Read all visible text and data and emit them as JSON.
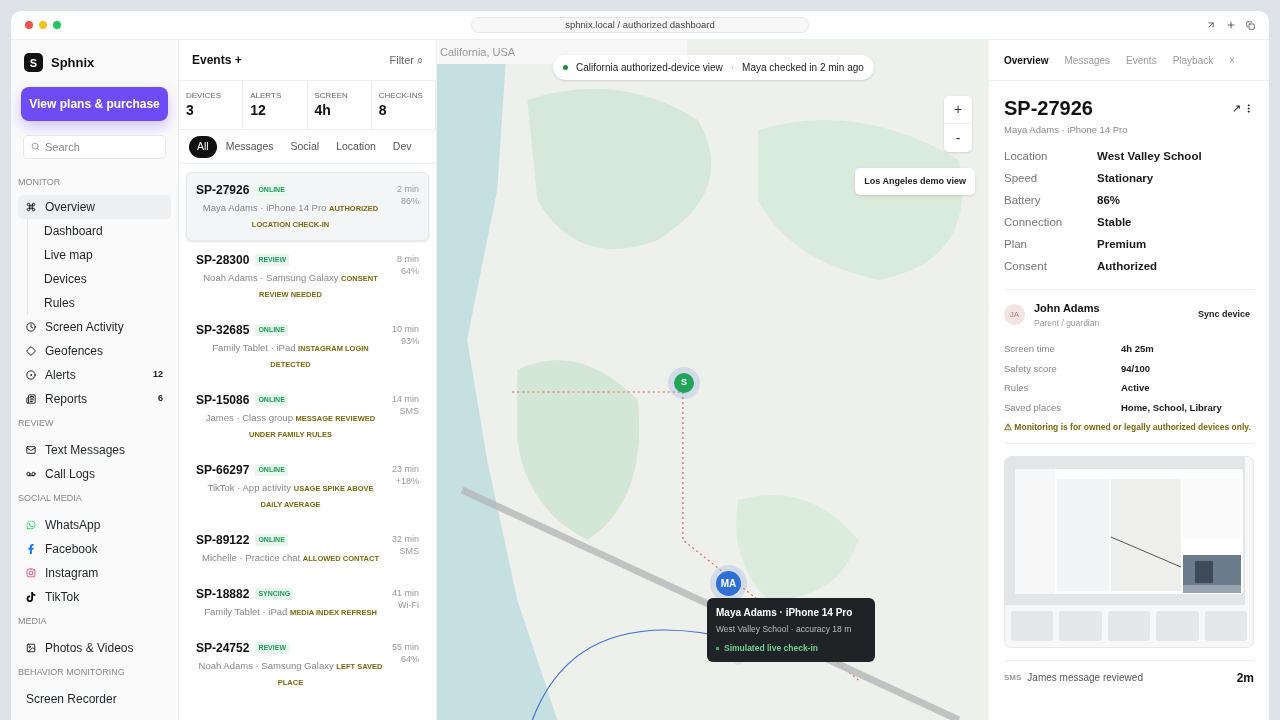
{
  "window": {
    "address": "sphnix.local / authorized dashboard"
  },
  "sidebar": {
    "logo": "S",
    "brand": "Sphnix",
    "cta": "View plans & purchase",
    "search": {
      "placeholder": "Search"
    },
    "sections": [
      {
        "title": "MONITOR",
        "items": [
          {
            "label": "Overview",
            "selected": true,
            "children": [
              {
                "label": "Dashboard",
                "selected": false
              },
              {
                "label": "Live map",
                "selected": false
              },
              {
                "label": "Devices",
                "selected": false
              },
              {
                "label": "Rules",
                "selected": false
              }
            ]
          },
          {
            "label": "Screen Activity",
            "selected": false
          },
          {
            "label": "Geofences",
            "selected": false
          },
          {
            "label": "Alerts",
            "selected": false,
            "count": "12"
          },
          {
            "label": "Reports",
            "selected": false,
            "count": "6"
          }
        ]
      },
      {
        "title": "REVIEW",
        "items": [
          {
            "label": "Text Messages",
            "selected": false
          },
          {
            "label": "Call Logs",
            "selected": false
          }
        ]
      },
      {
        "title": "SOCIAL MEDIA",
        "items": [
          {
            "label": "WhatsApp",
            "selected": false
          },
          {
            "label": "Facebook",
            "selected": false
          },
          {
            "label": "Instagram",
            "selected": false
          },
          {
            "label": "TikTok",
            "selected": false
          }
        ]
      },
      {
        "title": "MEDIA",
        "items": [
          {
            "label": "Photos & Videos",
            "selected": false
          }
        ]
      },
      {
        "title": "BEHAVIOR MONITORING",
        "items": [
          {
            "label": "Screen Recorder",
            "selected": false
          }
        ]
      }
    ]
  },
  "events": {
    "title": "Events +",
    "filter": "Filter ⌕",
    "stats": [
      {
        "label": "DEVICES",
        "value": "3"
      },
      {
        "label": "ALERTS",
        "value": "12"
      },
      {
        "label": "SCREEN",
        "value": "4h"
      },
      {
        "label": "CHECK-INS",
        "value": "8"
      }
    ],
    "tabs": [
      {
        "label": "All",
        "selected": true
      },
      {
        "label": "Messages",
        "selected": false
      },
      {
        "label": "Social",
        "selected": false
      },
      {
        "label": "Location",
        "selected": false
      },
      {
        "label": "Dev",
        "selected": false
      }
    ],
    "items": [
      {
        "id": "SP-27926",
        "status": "ONLINE",
        "subtitle": "Maya Adams · iPhone 14 Pro",
        "note": "AUTHORIZED LOCATION CHECK-IN",
        "time": "2 min",
        "meta": "86%",
        "selected": true
      },
      {
        "id": "SP-28300",
        "status": "REVIEW",
        "subtitle": "Noah Adams · Samsung Galaxy",
        "note": "CONSENT REVIEW NEEDED",
        "time": "8 min",
        "meta": "64%",
        "selected": false
      },
      {
        "id": "SP-32685",
        "status": "ONLINE",
        "subtitle": "Family Tablet · iPad",
        "note": "INSTAGRAM LOGIN DETECTED",
        "time": "10 min",
        "meta": "93%",
        "selected": false
      },
      {
        "id": "SP-15086",
        "status": "ONLINE",
        "subtitle": "James · Class group",
        "note": "MESSAGE REVIEWED UNDER FAMILY RULES",
        "time": "14 min",
        "meta": "SMS",
        "selected": false
      },
      {
        "id": "SP-66297",
        "status": "ONLINE",
        "subtitle": "TikTok · App activity",
        "note": "USAGE SPIKE ABOVE DAILY AVERAGE",
        "time": "23 min",
        "meta": "+18%",
        "selected": false
      },
      {
        "id": "SP-89122",
        "status": "ONLINE",
        "subtitle": "Michelle · Practice chat",
        "note": "ALLOWED CONTACT",
        "time": "32 min",
        "meta": "SMS",
        "selected": false
      },
      {
        "id": "SP-18882",
        "status": "SYNCING",
        "subtitle": "Family Tablet · iPad",
        "note": "MEDIA INDEX REFRESH",
        "time": "41 min",
        "meta": "Wi-Fi",
        "selected": false
      },
      {
        "id": "SP-24752",
        "status": "REVIEW",
        "subtitle": "Noah Adams · Samsung Galaxy",
        "note": "LEFT SAVED PLACE",
        "time": "55 min",
        "meta": "64%",
        "selected": false
      }
    ]
  },
  "map": {
    "search": {
      "placeholder": "California, USA"
    },
    "banner": {
      "view": "California authorized-device view",
      "separator": "·",
      "checkin": "Maya checked in 2 min ago"
    },
    "zoom_in": "+",
    "zoom_out": "-",
    "demo_button": "Los Angeles demo view",
    "pins": [
      {
        "label": "S",
        "color": "#22a35a"
      },
      {
        "label": "MA",
        "color": "#2f6fd6"
      }
    ],
    "tooltip": {
      "title": "Maya Adams · iPhone 14 Pro",
      "subtitle": "West Valley School · accuracy 18 m",
      "status": "Simulated live check-in"
    }
  },
  "details": {
    "tabs": [
      {
        "label": "Overview",
        "selected": true
      },
      {
        "label": "Messages",
        "selected": false
      },
      {
        "label": "Events",
        "selected": false
      },
      {
        "label": "Playback",
        "selected": false
      }
    ],
    "close": "×",
    "title": "SP-27926",
    "subtitle": "Maya Adams · iPhone 14 Pro",
    "open": "↗",
    "fields": [
      {
        "label": "Location",
        "value": "West Valley School"
      },
      {
        "label": "Speed",
        "value": "Stationary"
      },
      {
        "label": "Battery",
        "value": "86%"
      },
      {
        "label": "Connection",
        "value": "Stable"
      },
      {
        "label": "Plan",
        "value": "Premium"
      },
      {
        "label": "Consent",
        "value": "Authorized"
      }
    ],
    "guardian": {
      "initials": "JA",
      "name": "John Adams",
      "role": "Parent / guardian",
      "action": "Sync device"
    },
    "stats": [
      {
        "label": "Screen time",
        "value": "4h 25m"
      },
      {
        "label": "Safety score",
        "value": "94/100"
      },
      {
        "label": "Rules",
        "value": "Active"
      },
      {
        "label": "Saved places",
        "value": "Home, School, Library"
      }
    ],
    "warning": "⚠ Monitoring is for owned or legally authorized devices only.",
    "activity": {
      "tag": "SMS",
      "text": "James message reviewed",
      "time": "2m"
    }
  }
}
